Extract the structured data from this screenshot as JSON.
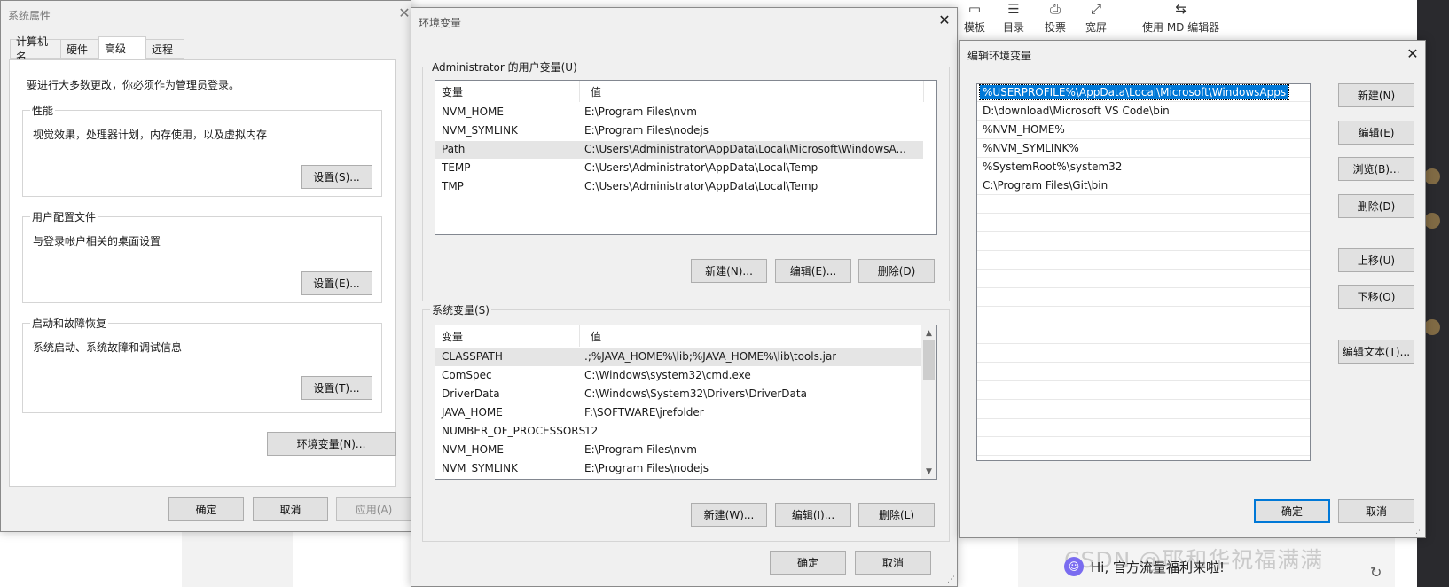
{
  "background_toolbar": {
    "items": [
      {
        "icon": "template-icon",
        "label": "模板"
      },
      {
        "icon": "outline-icon",
        "label": "目录"
      },
      {
        "icon": "vote-icon",
        "label": "投票"
      },
      {
        "icon": "widescreen-icon",
        "label": "宽屏"
      },
      {
        "icon": "switch-editor-icon",
        "label": "使用 MD 编辑器"
      }
    ]
  },
  "background_chat": {
    "message": "Hi, 官方流量福利来啦!",
    "watermark": "CSDN @耶和华祝福满满"
  },
  "system_properties": {
    "title": "系统属性",
    "tabs": [
      "计算机名",
      "硬件",
      "高级",
      "远程"
    ],
    "active_tab": "高级",
    "admin_note": "要进行大多数更改，你必须作为管理员登录。",
    "groups": [
      {
        "label": "性能",
        "desc": "视觉效果，处理器计划，内存使用，以及虚拟内存",
        "button": "设置(S)..."
      },
      {
        "label": "用户配置文件",
        "desc": "与登录帐户相关的桌面设置",
        "button": "设置(E)..."
      },
      {
        "label": "启动和故障恢复",
        "desc": "系统启动、系统故障和调试信息",
        "button": "设置(T)..."
      }
    ],
    "env_button": "环境变量(N)...",
    "ok": "确定",
    "cancel": "取消",
    "apply": "应用(A)"
  },
  "environment_variables": {
    "title": "环境变量",
    "user_section_label": "Administrator 的用户变量(U)",
    "columns": [
      "变量",
      "值"
    ],
    "user_vars": [
      {
        "name": "NVM_HOME",
        "value": "E:\\Program Files\\nvm"
      },
      {
        "name": "NVM_SYMLINK",
        "value": "E:\\Program Files\\nodejs"
      },
      {
        "name": "Path",
        "value": "C:\\Users\\Administrator\\AppData\\Local\\Microsoft\\WindowsA..."
      },
      {
        "name": "TEMP",
        "value": "C:\\Users\\Administrator\\AppData\\Local\\Temp"
      },
      {
        "name": "TMP",
        "value": "C:\\Users\\Administrator\\AppData\\Local\\Temp"
      }
    ],
    "user_selected": "Path",
    "user_buttons": {
      "new": "新建(N)...",
      "edit": "编辑(E)...",
      "delete": "删除(D)"
    },
    "system_section_label": "系统变量(S)",
    "system_vars": [
      {
        "name": "CLASSPATH",
        "value": ".;%JAVA_HOME%\\lib;%JAVA_HOME%\\lib\\tools.jar"
      },
      {
        "name": "ComSpec",
        "value": "C:\\Windows\\system32\\cmd.exe"
      },
      {
        "name": "DriverData",
        "value": "C:\\Windows\\System32\\Drivers\\DriverData"
      },
      {
        "name": "JAVA_HOME",
        "value": "F:\\SOFTWARE\\jrefolder"
      },
      {
        "name": "NUMBER_OF_PROCESSORS",
        "value": "12"
      },
      {
        "name": "NVM_HOME",
        "value": "E:\\Program Files\\nvm"
      },
      {
        "name": "NVM_SYMLINK",
        "value": "E:\\Program Files\\nodejs"
      }
    ],
    "system_selected": "CLASSPATH",
    "system_buttons": {
      "new": "新建(W)...",
      "edit": "编辑(I)...",
      "delete": "删除(L)"
    },
    "ok": "确定",
    "cancel": "取消"
  },
  "edit_env": {
    "title": "编辑环境变量",
    "entries": [
      "%USERPROFILE%\\AppData\\Local\\Microsoft\\WindowsApps",
      "D:\\download\\Microsoft VS Code\\bin",
      "%NVM_HOME%",
      "%NVM_SYMLINK%",
      "%SystemRoot%\\system32",
      "C:\\Program Files\\Git\\bin"
    ],
    "selected_index": 0,
    "buttons": {
      "new": "新建(N)",
      "edit": "编辑(E)",
      "browse": "浏览(B)...",
      "delete": "删除(D)",
      "move_up": "上移(U)",
      "move_down": "下移(O)",
      "edit_text": "编辑文本(T)..."
    },
    "ok": "确定",
    "cancel": "取消"
  },
  "colors": {
    "selection": "#0078d7",
    "dialog_bg": "#f0f0f0"
  }
}
